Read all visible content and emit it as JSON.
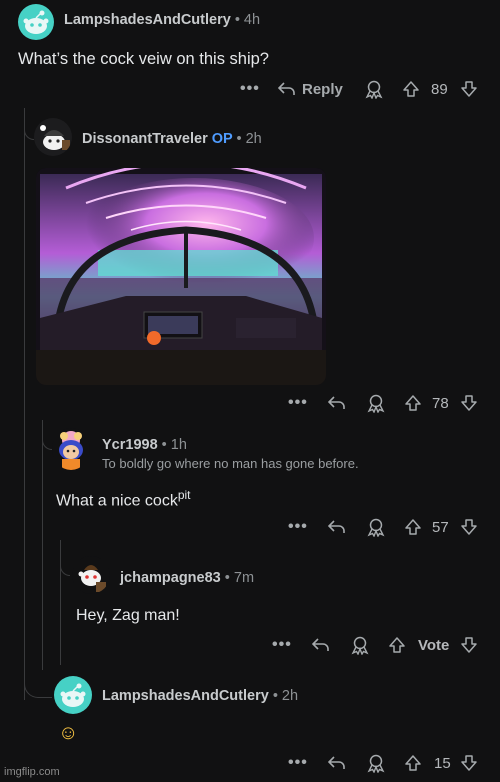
{
  "comments": [
    {
      "username": "LampshadesAndCutlery",
      "time": "• 4h",
      "body": "What’s the cock veiw on this ship?",
      "reply_label": "Reply",
      "votes": "89"
    },
    {
      "username": "DissonantTraveler",
      "op_badge": "OP",
      "time": "• 2h",
      "votes": "78"
    },
    {
      "username": "Ycr1998",
      "time": "• 1h",
      "flair": "To boldly go where no man has gone before.",
      "body_main": "What a nice cock",
      "body_sup": "pit",
      "votes": "57"
    },
    {
      "username": "jchampagne83",
      "time": "• 7m",
      "body": "Hey, Zag man!",
      "votes": "Vote"
    },
    {
      "username": "LampshadesAndCutlery",
      "time": "• 2h",
      "body": "☺",
      "votes": "15"
    }
  ],
  "icons": {
    "more": "more-options-icon",
    "reply": "reply-arrow-icon",
    "award": "award-icon",
    "upvote": "upvote-arrow-icon",
    "downvote": "downvote-arrow-icon"
  },
  "dots": "•••",
  "watermark": "imgflip.com",
  "colors": {
    "background": "#111112",
    "op_blue": "#4f9cff",
    "snoo_teal": "#46d1c5"
  }
}
